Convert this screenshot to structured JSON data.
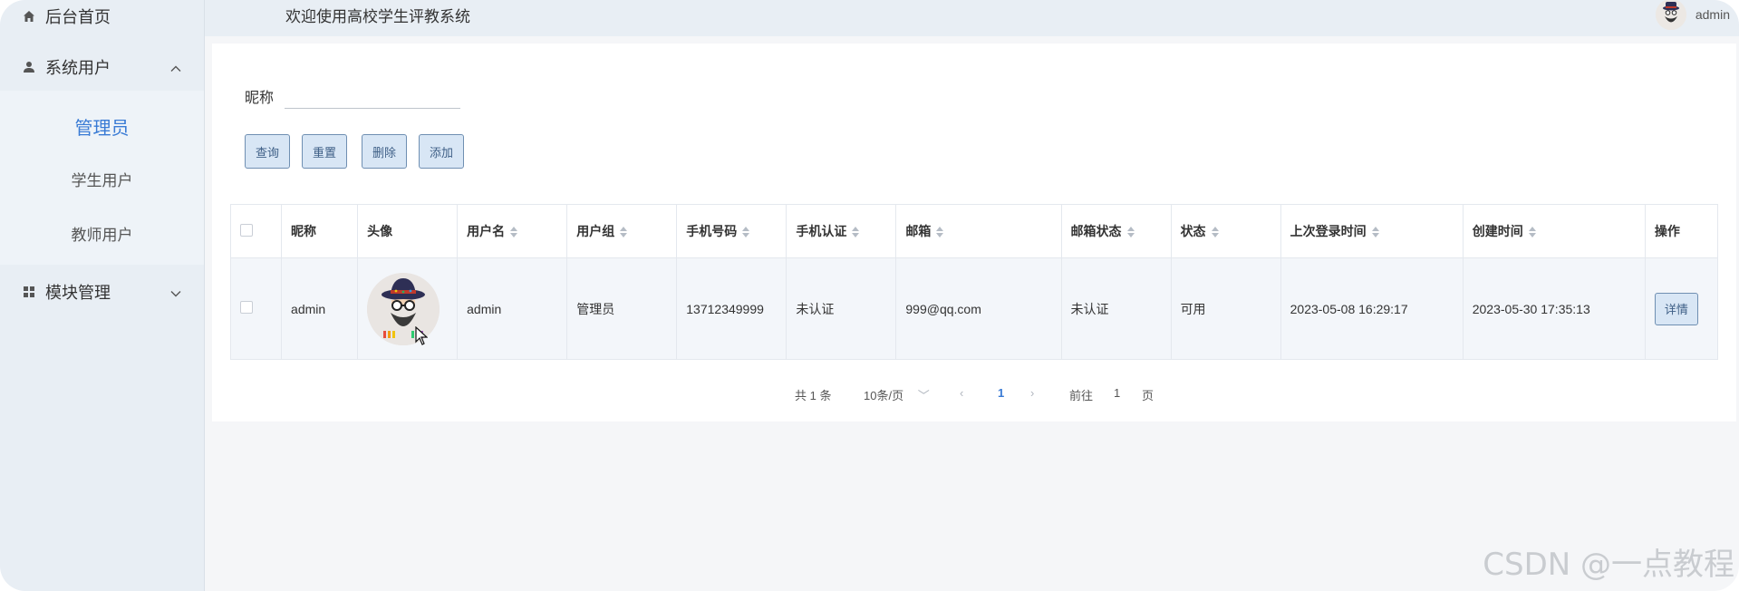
{
  "sidebar": {
    "home": "后台首页",
    "system_users": "系统用户",
    "sub_items": [
      "管理员",
      "学生用户",
      "教师用户"
    ],
    "module_mgmt": "模块管理"
  },
  "header": {
    "welcome": "欢迎使用高校学生评教系统",
    "username": "admin"
  },
  "search": {
    "label": "昵称",
    "value": "",
    "placeholder": ""
  },
  "toolbar": {
    "query": "查询",
    "reset": "重置",
    "delete": "删除",
    "add": "添加"
  },
  "table": {
    "headers": [
      "昵称",
      "头像",
      "用户名",
      "用户组",
      "手机号码",
      "手机认证",
      "邮箱",
      "邮箱状态",
      "状态",
      "上次登录时间",
      "创建时间",
      "操作"
    ],
    "rows": [
      {
        "nickname": "admin",
        "username": "admin",
        "group": "管理员",
        "phone": "13712349999",
        "phone_verified": "未认证",
        "email": "999@qq.com",
        "email_status": "未认证",
        "status": "可用",
        "last_login": "2023-05-08 16:29:17",
        "created": "2023-05-30 17:35:13",
        "action": "详情"
      }
    ]
  },
  "pagination": {
    "total": "共 1 条",
    "page_size": "10条/页",
    "current": "1",
    "goto_prefix": "前往",
    "goto_value": "1",
    "goto_suffix": "页"
  },
  "watermark": "CSDN @一点教程",
  "colors": {
    "accent": "#3a7bd5",
    "sidebar_bg": "#e8eef4",
    "button_bg": "#d8e6f5",
    "button_border": "#6f8fb2"
  }
}
